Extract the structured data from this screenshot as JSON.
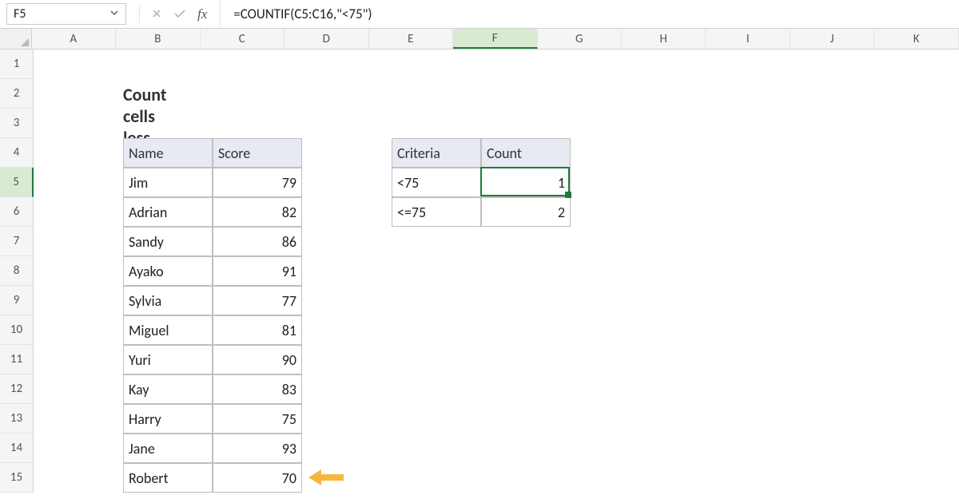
{
  "namebox": "F5",
  "formula": "=COUNTIF(C5:C16,\"<75\")",
  "fx_label": "fx",
  "columns": [
    "A",
    "B",
    "C",
    "D",
    "E",
    "F",
    "G",
    "H",
    "I",
    "J",
    "K"
  ],
  "row_labels": [
    "1",
    "2",
    "3",
    "4",
    "5",
    "6",
    "7",
    "8",
    "9",
    "10",
    "11",
    "12",
    "13",
    "14",
    "15"
  ],
  "active_col_index": 5,
  "active_row_index": 4,
  "title": "Count cells less than",
  "table1": {
    "headers": [
      "Name",
      "Score"
    ],
    "rows": [
      {
        "name": "Jim",
        "score": "79"
      },
      {
        "name": "Adrian",
        "score": "82"
      },
      {
        "name": "Sandy",
        "score": "86"
      },
      {
        "name": "Ayako",
        "score": "91"
      },
      {
        "name": "Sylvia",
        "score": "77"
      },
      {
        "name": "Miguel",
        "score": "81"
      },
      {
        "name": "Yuri",
        "score": "90"
      },
      {
        "name": "Kay",
        "score": "83"
      },
      {
        "name": "Harry",
        "score": "75"
      },
      {
        "name": "Jane",
        "score": "93"
      },
      {
        "name": "Robert",
        "score": "70"
      }
    ]
  },
  "table2": {
    "headers": [
      "Criteria",
      "Count"
    ],
    "rows": [
      {
        "criteria": "<75",
        "count": "1"
      },
      {
        "criteria": "<=75",
        "count": "2"
      }
    ]
  },
  "icon_names": {
    "cancel": "✕",
    "enter": "✓",
    "divider": ":"
  }
}
